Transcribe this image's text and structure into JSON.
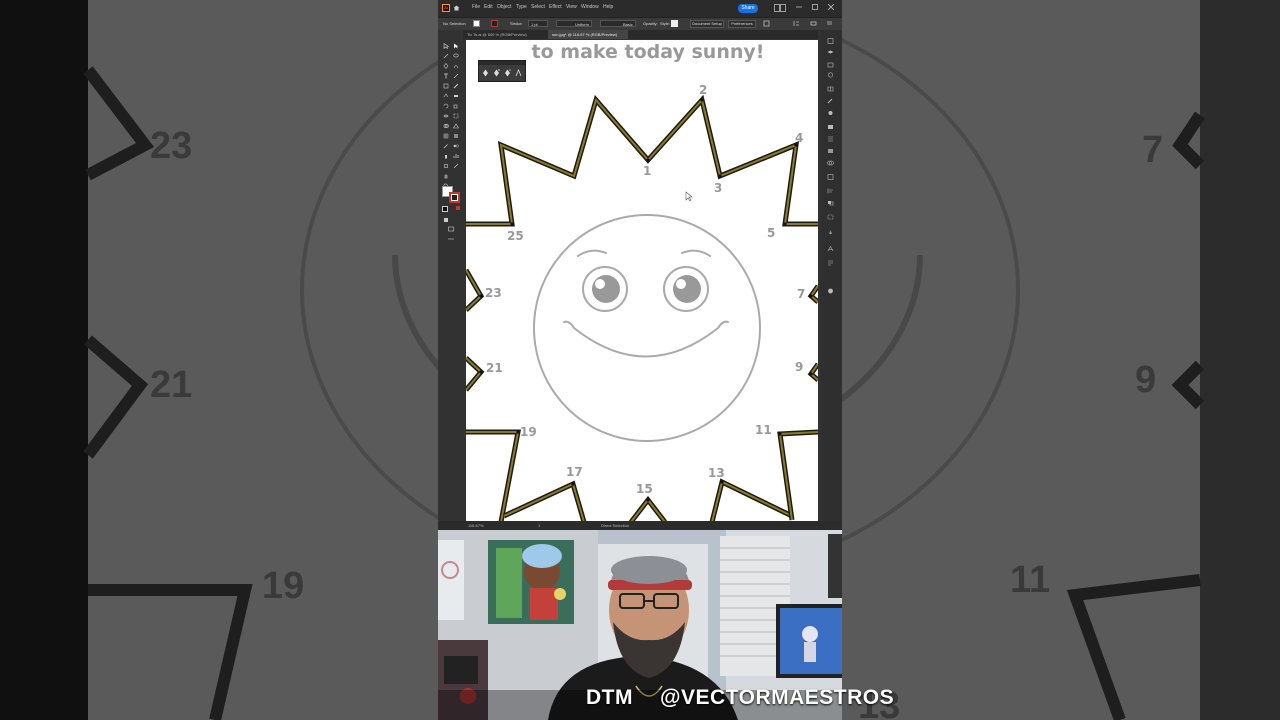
{
  "background": {
    "numbers": [
      "23",
      "21",
      "19",
      "13",
      "7",
      "9",
      "11"
    ]
  },
  "menu": {
    "items": [
      "File",
      "Edit",
      "Object",
      "Type",
      "Select",
      "Effect",
      "View",
      "Window",
      "Help"
    ],
    "share_label": "Share"
  },
  "control_bar": {
    "selection": "No Selection",
    "stroke_label": "Stroke:",
    "stroke_value": "1 pt",
    "uniform_label": "Uniform",
    "basic_label": "Basic",
    "opacity_label": "Opacity:",
    "style_label": "Style:",
    "document_setup": "Document Setup",
    "preferences": "Preferences"
  },
  "tabs": [
    {
      "label": "Tic Ts.ai @ 800 % (RGB/Preview)",
      "active": false
    },
    {
      "label": "sun.jpg* @ 116.67 % (RGB/Preview)",
      "active": true
    }
  ],
  "artboard": {
    "headline": "to make today sunny!",
    "points": [
      {
        "label": "1"
      },
      {
        "label": "2"
      },
      {
        "label": "3"
      },
      {
        "label": "4"
      },
      {
        "label": "5"
      },
      {
        "label": "7"
      },
      {
        "label": "9"
      },
      {
        "label": "11"
      },
      {
        "label": "13"
      },
      {
        "label": "15"
      },
      {
        "label": "17"
      },
      {
        "label": "19"
      },
      {
        "label": "21"
      },
      {
        "label": "23"
      },
      {
        "label": "25"
      }
    ]
  },
  "status": {
    "zoom": "116.67%",
    "tool": "Direct Selection",
    "artboard_num": "1"
  },
  "caption": {
    "left": "DTM",
    "right": "@VECTORMAESTROS"
  },
  "colors": {
    "accent": "#1473e6",
    "stroke_gold": "#8a7a2a",
    "stroke_dark": "#1e1a14"
  }
}
